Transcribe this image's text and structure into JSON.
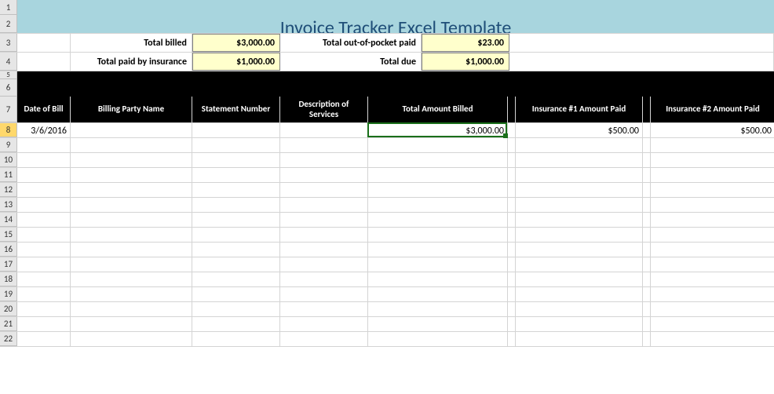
{
  "title": "Invoice Tracker Excel Template",
  "rowNumbers": [
    "1",
    "2",
    "3",
    "4",
    "5",
    "6",
    "7",
    "8",
    "9",
    "10",
    "11",
    "12",
    "13",
    "14",
    "15",
    "16",
    "17",
    "18",
    "19",
    "20",
    "21",
    "22"
  ],
  "summary": {
    "r1": {
      "label1": "Total billed",
      "val1": "$3,000.00",
      "label2": "Total out-of-pocket paid",
      "val2": "$23.00"
    },
    "r2": {
      "label1": "Total paid by insurance",
      "val1": "$1,000.00",
      "label2": "Total due",
      "val2": "$1,000.00"
    }
  },
  "columns": {
    "A": "Date of Bill",
    "B": "Billing Party Name",
    "C": "Statement Number",
    "D": "Description of Services",
    "E": "Total Amount Billed",
    "G": "Insurance #1 Amount Paid",
    "I": "Insurance #2 Amount Paid"
  },
  "data": {
    "date": "3/6/2016",
    "billed": "$3,000.00",
    "ins1": "$500.00",
    "ins2": "$500.00"
  },
  "activeCell": "E8"
}
